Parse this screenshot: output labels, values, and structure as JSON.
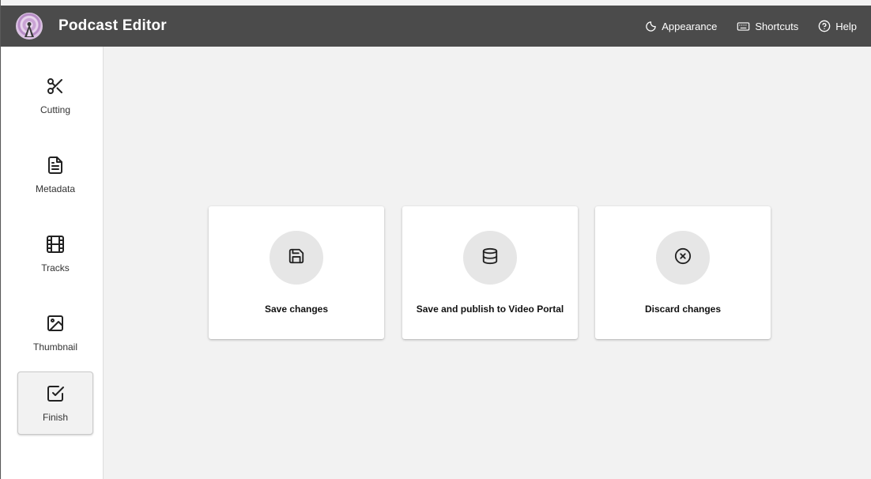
{
  "header": {
    "title": "Podcast Editor",
    "logo_icon": "podcast-antenna-logo",
    "actions": [
      {
        "label": "Appearance",
        "icon": "moon-icon"
      },
      {
        "label": "Shortcuts",
        "icon": "keyboard-icon"
      },
      {
        "label": "Help",
        "icon": "help-circle-icon"
      }
    ]
  },
  "sidebar": {
    "items": [
      {
        "label": "Cutting",
        "icon": "scissors-icon",
        "active": false
      },
      {
        "label": "Metadata",
        "icon": "document-icon",
        "active": false
      },
      {
        "label": "Tracks",
        "icon": "film-icon",
        "active": false
      },
      {
        "label": "Thumbnail",
        "icon": "image-icon",
        "active": false
      },
      {
        "label": "Finish",
        "icon": "checkbox-icon",
        "active": true
      }
    ]
  },
  "main": {
    "cards": [
      {
        "label": "Save changes",
        "icon": "save-icon"
      },
      {
        "label": "Save and publish to Video Portal",
        "icon": "database-icon"
      },
      {
        "label": "Discard changes",
        "icon": "close-circle-icon"
      }
    ]
  },
  "colors": {
    "header_bg": "#4b4b4b",
    "main_bg": "#f2f2f2",
    "sidebar_bg": "#ffffff",
    "icon_circle_bg": "#e6e6e6"
  }
}
